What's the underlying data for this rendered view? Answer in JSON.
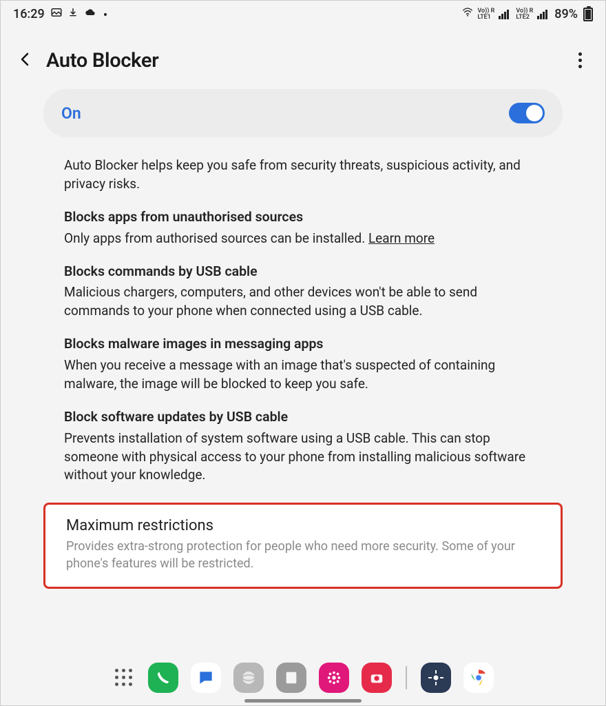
{
  "status": {
    "time": "16:29",
    "battery_pct": "89%"
  },
  "header": {
    "title": "Auto Blocker"
  },
  "toggle": {
    "label": "On"
  },
  "description": "Auto Blocker helps keep you safe from security threats, suspicious activity, and privacy risks.",
  "sections": [
    {
      "title": "Blocks apps from unauthorised sources",
      "body": "Only apps from authorised sources can be installed. ",
      "link": "Learn more"
    },
    {
      "title": "Blocks commands by USB cable",
      "body": "Malicious chargers, computers, and other devices won't be able to send commands to your phone when connected using a USB cable."
    },
    {
      "title": "Blocks malware images in messaging apps",
      "body": "When you receive a message with an image that's suspected of containing malware, the image will be blocked to keep you safe."
    },
    {
      "title": "Block software updates by USB cable",
      "body": "Prevents installation of system software using a USB cable. This can stop someone with physical access to your phone from installing malicious software without your knowledge."
    }
  ],
  "max": {
    "title": "Maximum restrictions",
    "desc": "Provides extra-strong protection for people who need more security. Some of your phone's features will be restricted."
  },
  "dock": {
    "apps": [
      "phone",
      "messages",
      "browser",
      "notes",
      "gallery",
      "camera",
      "settings",
      "chrome"
    ]
  }
}
